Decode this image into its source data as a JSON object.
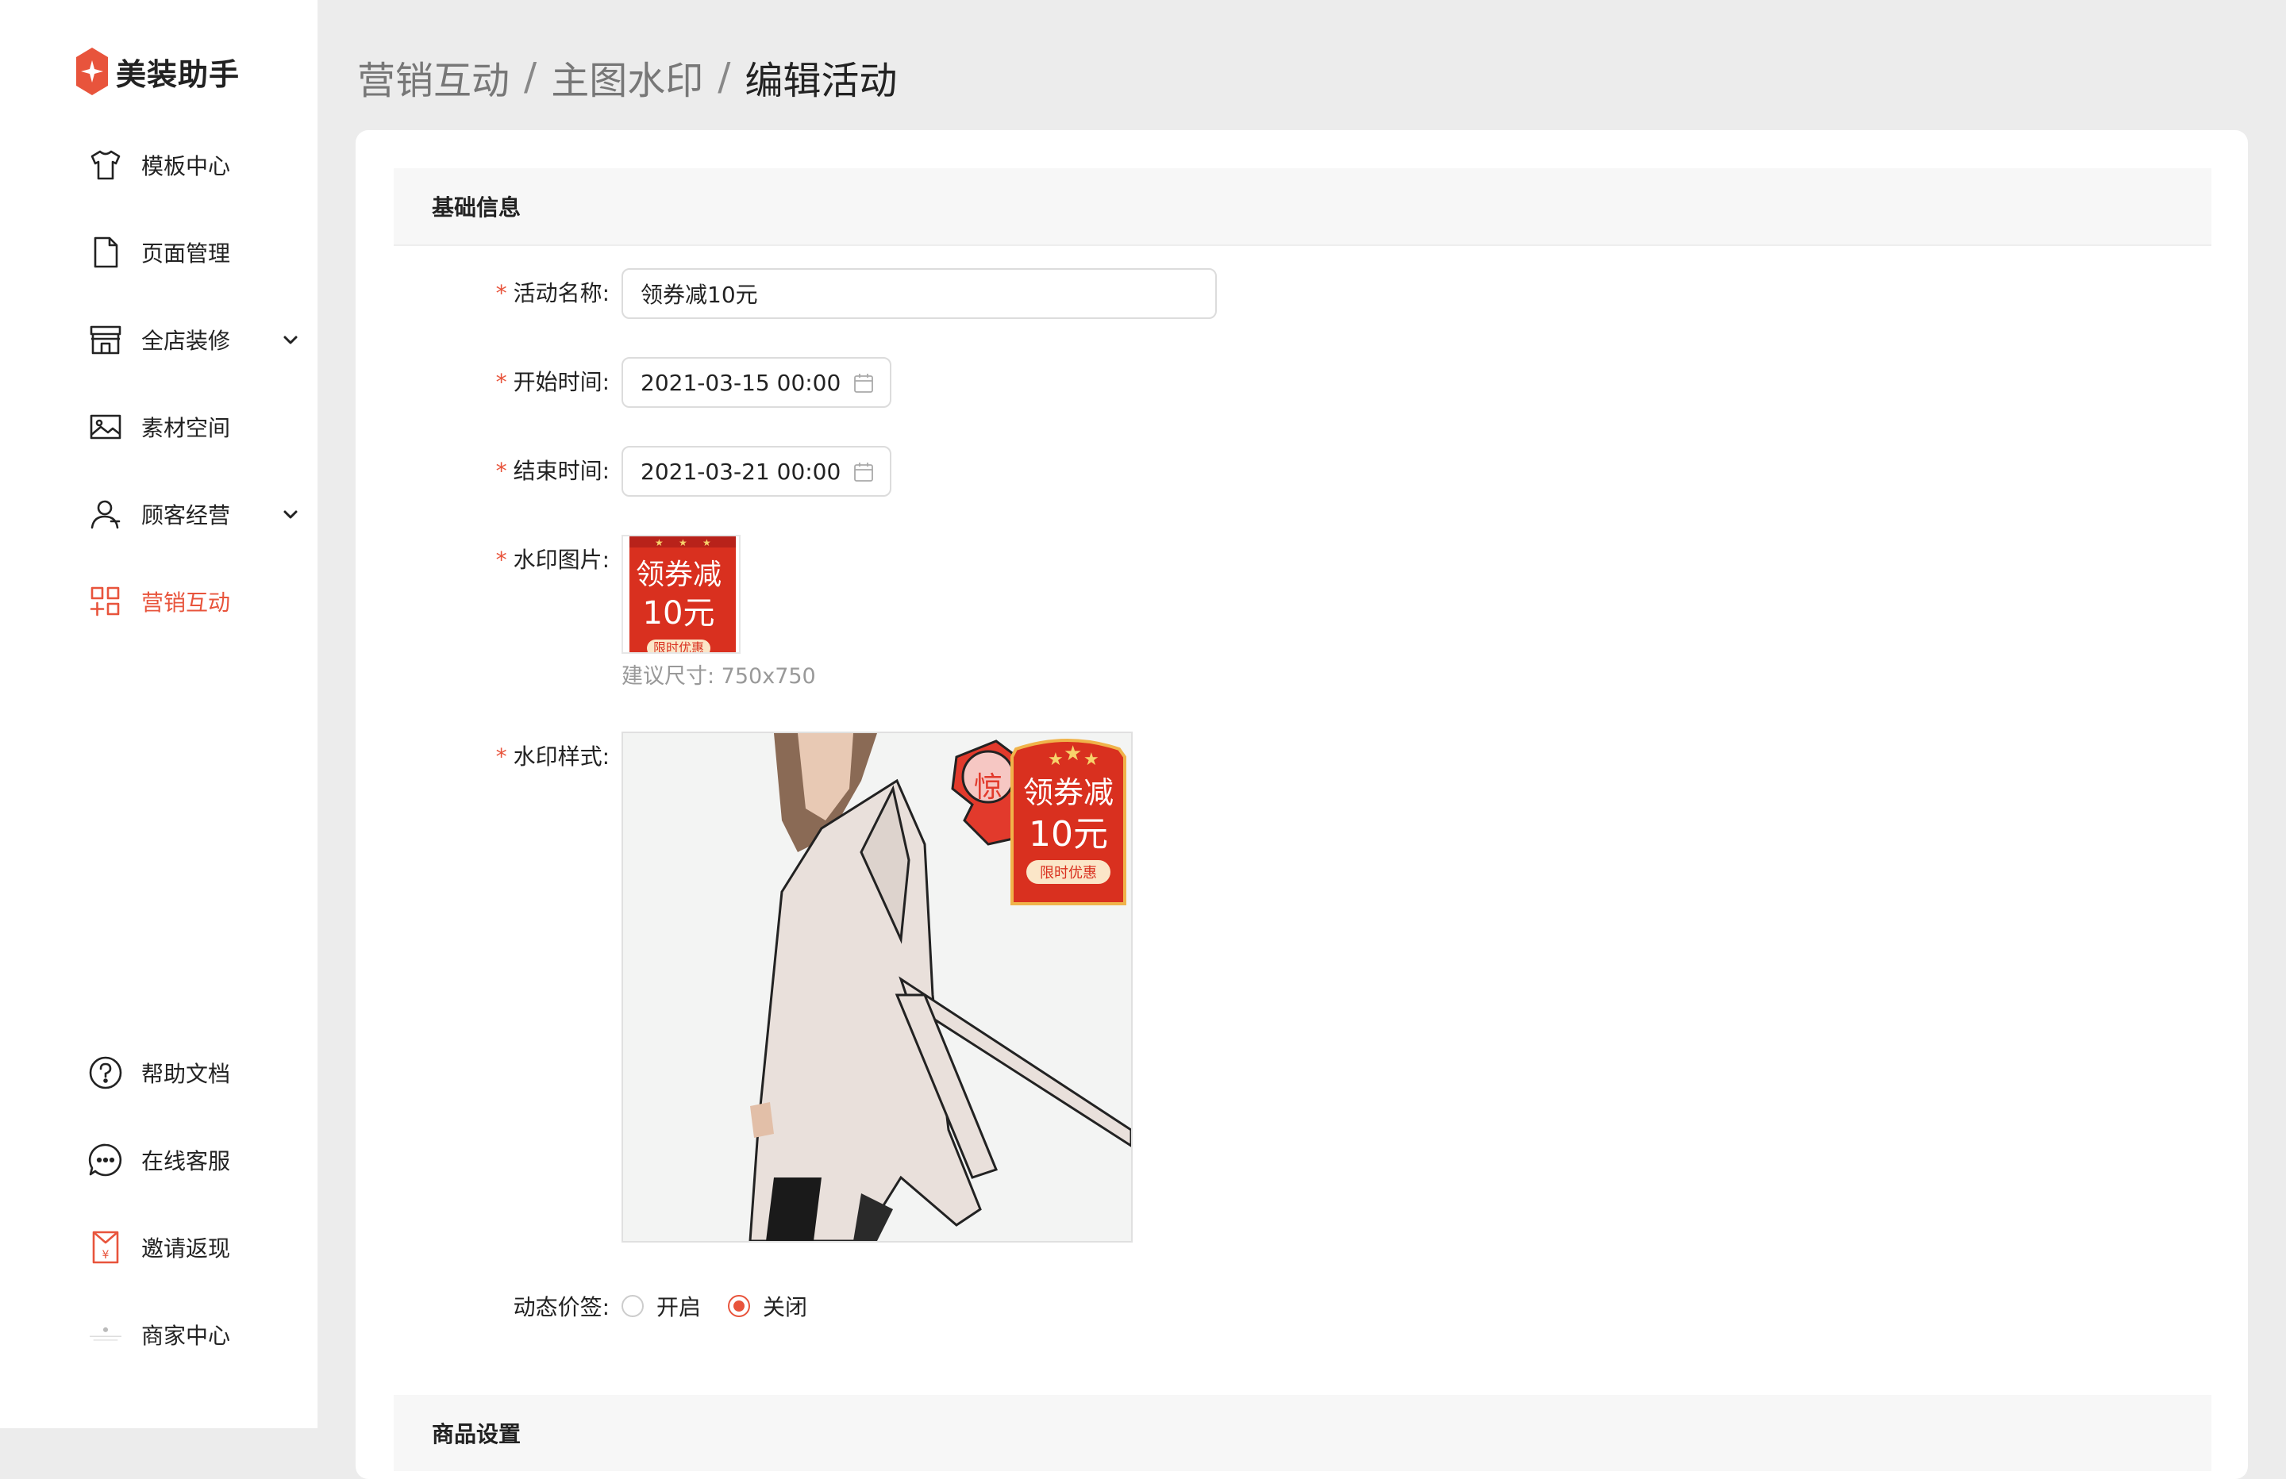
{
  "brand": {
    "name": "美装助手",
    "accent": "#e8543c"
  },
  "sidebar": {
    "items": [
      {
        "label": "模板中心",
        "icon": "tshirt-icon"
      },
      {
        "label": "页面管理",
        "icon": "document-icon"
      },
      {
        "label": "全店装修",
        "icon": "storefront-icon",
        "expandable": true
      },
      {
        "label": "素材空间",
        "icon": "image-icon"
      },
      {
        "label": "顾客经营",
        "icon": "user-icon",
        "expandable": true
      },
      {
        "label": "营销互动",
        "icon": "grid-plus-icon",
        "active": true
      }
    ],
    "bottom_items": [
      {
        "label": "帮助文档",
        "icon": "help-circle-icon"
      },
      {
        "label": "在线客服",
        "icon": "chat-bubble-icon"
      },
      {
        "label": "邀请返现",
        "icon": "red-envelope-icon"
      },
      {
        "label": "商家中心",
        "icon": "merchant-avatar-icon"
      }
    ]
  },
  "breadcrumb": {
    "level1": "营销互动",
    "level2": "主图水印",
    "current": "编辑活动",
    "separator": "/"
  },
  "form": {
    "section_title": "基础信息",
    "name_label": "活动名称:",
    "name_value": "领券减10元",
    "start_label": "开始时间:",
    "start_value": "2021-03-15 00:00",
    "end_label": "结束时间:",
    "end_value": "2021-03-21 00:00",
    "watermark_label": "水印图片:",
    "watermark_hint": "建议尺寸: 750x750",
    "style_label": "水印样式:",
    "dynamic_price_label": "动态价签:",
    "radio_on": "开启",
    "radio_off": "关闭",
    "dynamic_price_selected": "关闭",
    "required_mark": "*"
  },
  "badge": {
    "line1": "领券减",
    "line2": "10元",
    "line3": "限时优惠"
  },
  "section2_title": "商品设置"
}
